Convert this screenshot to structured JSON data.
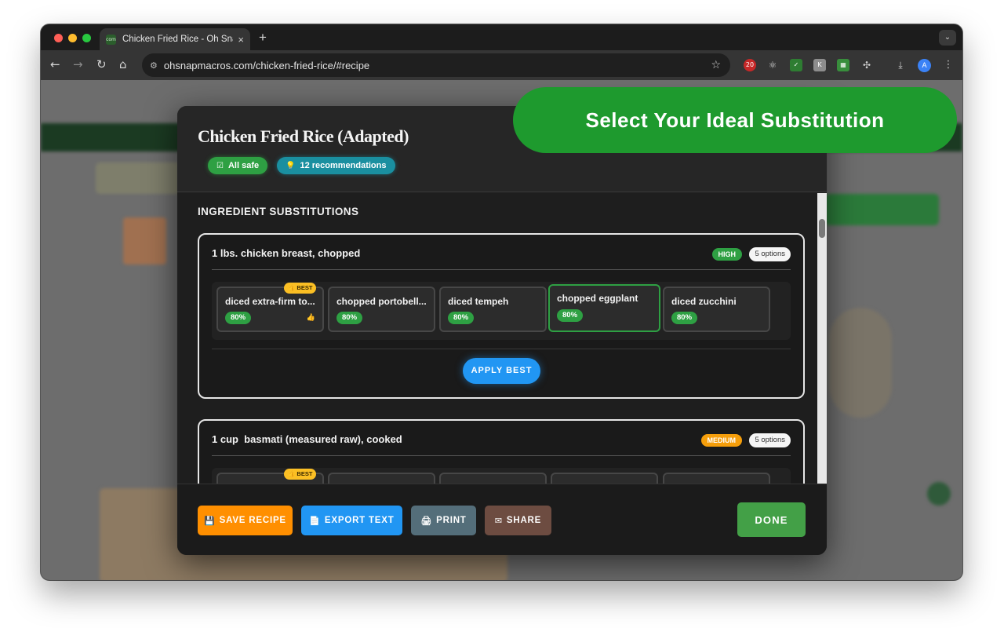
{
  "browser": {
    "tab_title": "Chicken Fried Rice - Oh Snap",
    "favicon_text": "com",
    "url": "ohsnapmacros.com/chicken-fried-rice/#recipe",
    "extension_badge": "20",
    "profile_initial": "A"
  },
  "banner": {
    "text": "Select Your Ideal Substitution"
  },
  "modal": {
    "title": "Chicken Fried Rice (Adapted)",
    "badges": {
      "safe": "All safe",
      "recommendations": "12 recommendations"
    },
    "section_title": "INGREDIENT SUBSTITUTIONS",
    "ingredients": [
      {
        "name": "1 lbs. chicken breast, chopped",
        "level": "HIGH",
        "options_count": "5 options",
        "options": [
          {
            "label": "diced extra-firm to...",
            "match": "80%",
            "best": "👍 BEST"
          },
          {
            "label": "chopped portobell...",
            "match": "80%"
          },
          {
            "label": "diced tempeh",
            "match": "80%"
          },
          {
            "label": "chopped eggplant",
            "match": "80%",
            "selected": true
          },
          {
            "label": "diced zucchini",
            "match": "80%"
          }
        ],
        "apply_label": "APPLY BEST"
      },
      {
        "name": "1 cup  basmati (measured raw), cooked",
        "level": "MEDIUM",
        "options_count": "5 options",
        "best_badge": "👍 BEST"
      }
    ],
    "footer": {
      "save": "SAVE RECIPE",
      "export": "EXPORT TEXT",
      "print": "PRINT",
      "share": "SHARE",
      "done": "DONE"
    }
  },
  "colors": {
    "accent_green": "#2ea043",
    "banner_green": "#1e9a2e",
    "save_orange": "#ff8f00",
    "export_blue": "#2196f3",
    "print_slate": "#546e7a",
    "share_brown": "#6d4c41",
    "medium_orange": "#f59e0b"
  }
}
